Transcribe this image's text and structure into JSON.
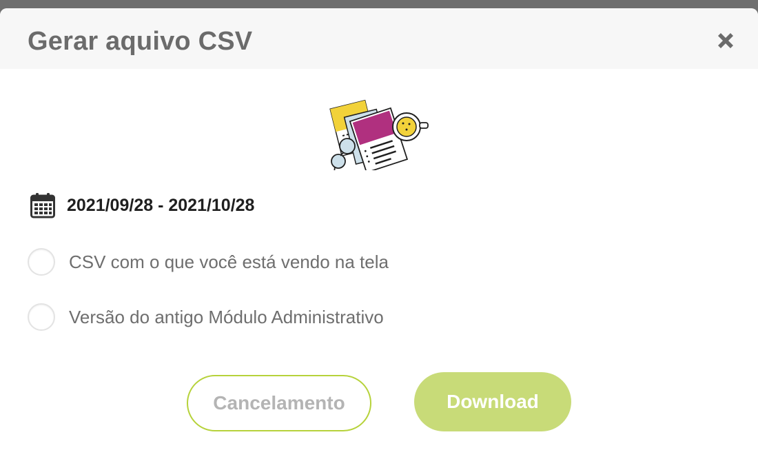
{
  "modal": {
    "title": "Gerar aquivo CSV",
    "close_icon": "close-icon"
  },
  "illustration": {
    "icon": "documents-illustration",
    "colors": {
      "yellow": "#f2d23a",
      "magenta": "#b0307f",
      "light_blue": "#cde0ea",
      "outline": "#1f1f1f"
    }
  },
  "date_range": {
    "icon": "calendar-icon",
    "value": "2021/09/28 - 2021/10/28"
  },
  "options": [
    {
      "label": "CSV com o que você está vendo na tela",
      "selected": false
    },
    {
      "label": "Versão do antigo Módulo Administrativo",
      "selected": false
    }
  ],
  "actions": {
    "cancel_label": "Cancelamento",
    "download_label": "Download"
  },
  "colors": {
    "accent": "#b6d23a",
    "download_bg": "#c8db78",
    "title_text": "#6b6b6b",
    "header_bg": "#f7f7f7"
  }
}
